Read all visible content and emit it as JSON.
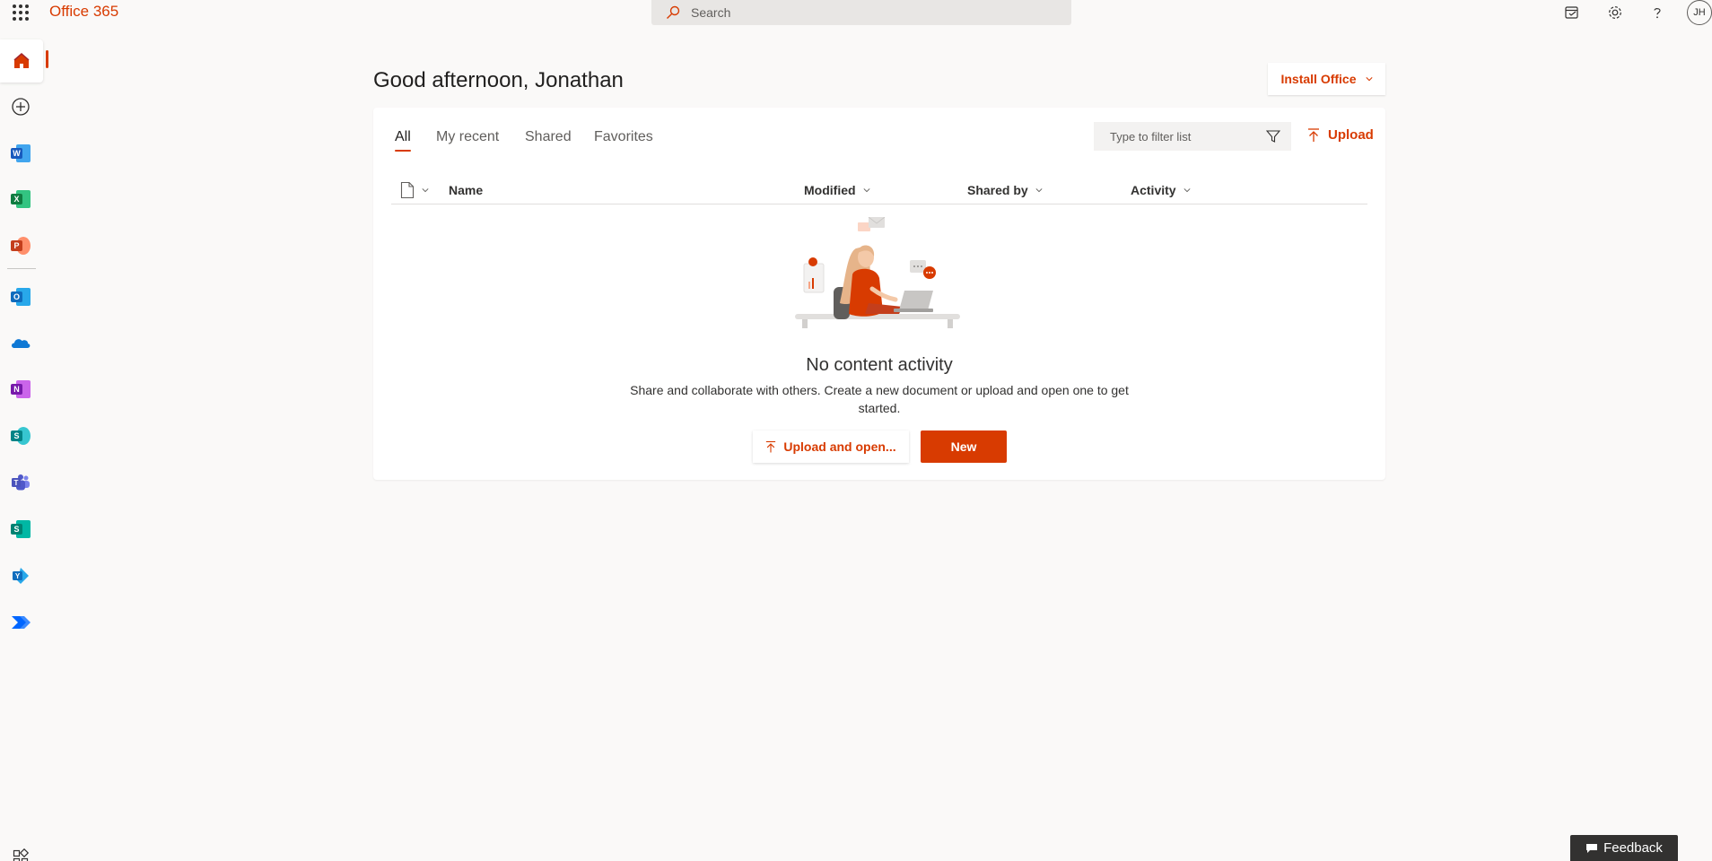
{
  "header": {
    "brand": "Office 365",
    "search_placeholder": "Search",
    "avatar_initials": "JH",
    "icons": [
      "app-launcher-icon",
      "my-day-icon",
      "settings-icon",
      "help-icon"
    ]
  },
  "rail": {
    "items": [
      {
        "name": "home",
        "icon": "home-icon",
        "active": true
      },
      {
        "name": "create",
        "icon": "add-circle-icon"
      },
      {
        "name": "word",
        "icon": "word-icon",
        "letter": "W",
        "color": "#185abd"
      },
      {
        "name": "excel",
        "icon": "excel-icon",
        "letter": "X",
        "color": "#107c41"
      },
      {
        "name": "powerpoint",
        "icon": "powerpoint-icon",
        "letter": "P",
        "color": "#c43e1c"
      },
      {
        "name": "outlook",
        "icon": "outlook-icon",
        "letter": "O",
        "color": "#0f6cbd"
      },
      {
        "name": "onedrive",
        "icon": "onedrive-icon",
        "color": "#0f78d4"
      },
      {
        "name": "onenote",
        "icon": "onenote-icon",
        "letter": "N",
        "color": "#7719aa"
      },
      {
        "name": "sharepoint",
        "icon": "sharepoint-icon",
        "letter": "S",
        "color": "#038387"
      },
      {
        "name": "teams",
        "icon": "teams-icon",
        "color": "#5059c9"
      },
      {
        "name": "sway",
        "icon": "sway-icon",
        "letter": "S",
        "color": "#008272"
      },
      {
        "name": "yammer",
        "icon": "yammer-icon",
        "letter": "Y",
        "color": "#106ebe"
      },
      {
        "name": "power-automate",
        "icon": "power-automate-icon",
        "color": "#0066ff"
      }
    ],
    "bottom_icon": "all-apps-icon"
  },
  "main": {
    "greeting": "Good afternoon, Jonathan",
    "install_office_label": "Install Office",
    "tabs": [
      {
        "label": "All",
        "active": true
      },
      {
        "label": "My recent"
      },
      {
        "label": "Shared"
      },
      {
        "label": "Favorites"
      }
    ],
    "filter_placeholder": "Type to filter list",
    "upload_label": "Upload",
    "columns": {
      "name": "Name",
      "modified": "Modified",
      "shared_by": "Shared by",
      "activity": "Activity"
    },
    "empty_state": {
      "title": "No content activity",
      "description": "Share and collaborate with others. Create a new document or upload and open one to get started.",
      "upload_open_label": "Upload and open...",
      "new_label": "New"
    }
  },
  "feedback_label": "Feedback",
  "colors": {
    "accent": "#d83b01",
    "background": "#faf9f8",
    "card": "#ffffff"
  }
}
